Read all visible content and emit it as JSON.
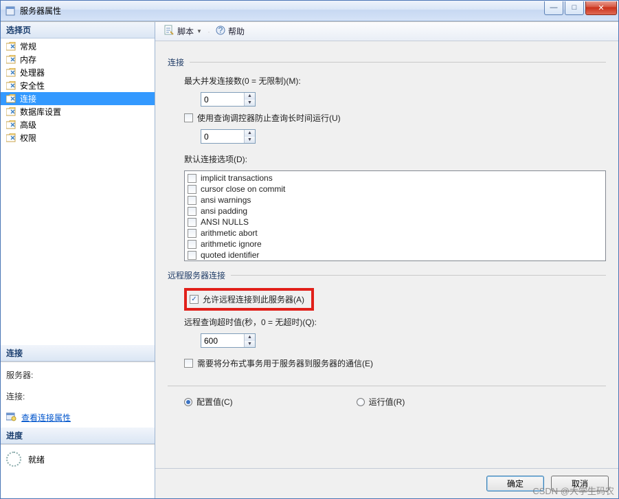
{
  "window": {
    "title": "服务器属性"
  },
  "sidebar": {
    "select_page_header": "选择页",
    "items": [
      {
        "label": "常规"
      },
      {
        "label": "内存"
      },
      {
        "label": "处理器"
      },
      {
        "label": "安全性"
      },
      {
        "label": "连接",
        "selected": true
      },
      {
        "label": "数据库设置"
      },
      {
        "label": "高级"
      },
      {
        "label": "权限"
      }
    ],
    "connection_header": "连接",
    "server_label": "服务器:",
    "server_value": "",
    "conn_label": "连接:",
    "conn_value": "",
    "view_props_link": "查看连接属性",
    "progress_header": "进度",
    "progress_status": "就绪"
  },
  "toolbar": {
    "script_label": "脚本",
    "help_label": "帮助"
  },
  "content": {
    "group_connections": "连接",
    "max_concurrent_label": "最大并发连接数(0 = 无限制)(M):",
    "max_concurrent_value": "0",
    "governor_label": "使用查询调控器防止查询长时间运行(U)",
    "governor_value": "0",
    "default_options_label": "默认连接选项(D):",
    "options": [
      "implicit transactions",
      "cursor close on commit",
      "ansi warnings",
      "ansi padding",
      "ANSI NULLS",
      "arithmetic abort",
      "arithmetic ignore",
      "quoted identifier"
    ],
    "group_remote": "远程服务器连接",
    "allow_remote_label": "允许远程连接到此服务器(A)",
    "remote_timeout_label": "远程查询超时值(秒，0 = 无超时)(Q):",
    "remote_timeout_value": "600",
    "dtc_label": "需要将分布式事务用于服务器到服务器的通信(E)",
    "configured_label": "配置值(C)",
    "running_label": "运行值(R)"
  },
  "footer": {
    "ok": "确定",
    "cancel": "取消"
  },
  "watermark": "CSDN @大学生码农"
}
